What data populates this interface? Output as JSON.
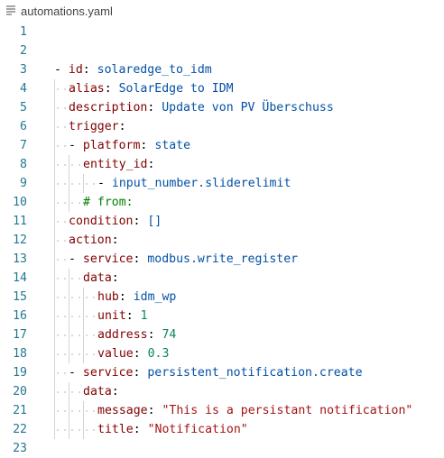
{
  "tab": {
    "icon": "file-lines-icon",
    "filename": "automations.yaml"
  },
  "colors": {
    "line_number": "#237893",
    "key": "#800000",
    "value": "#0451a5",
    "string": "#a31515",
    "number": "#098658",
    "comment": "#008000",
    "indent_guide": "#d3d3d3"
  },
  "lines": [
    {
      "n": "1"
    },
    {
      "n": "2"
    },
    {
      "n": "3",
      "dash": "- ",
      "key": "id",
      "colon": ": ",
      "value": "solaredge_to_idm"
    },
    {
      "n": "4",
      "key": "alias",
      "colon": ": ",
      "value": "SolarEdge to IDM"
    },
    {
      "n": "5",
      "key": "description",
      "colon": ": ",
      "value": "Update von PV Überschuss"
    },
    {
      "n": "6",
      "key": "trigger",
      "colon": ":"
    },
    {
      "n": "7",
      "dash": "- ",
      "key": "platform",
      "colon": ": ",
      "value": "state"
    },
    {
      "n": "8",
      "key": "entity_id",
      "colon": ":"
    },
    {
      "n": "9",
      "dash": "- ",
      "value": "input_number.sliderelimit"
    },
    {
      "n": "10",
      "comment": "# from:"
    },
    {
      "n": "11",
      "key": "condition",
      "colon": ": ",
      "value": "[]"
    },
    {
      "n": "12",
      "key": "action",
      "colon": ":"
    },
    {
      "n": "13",
      "dash": "- ",
      "key": "service",
      "colon": ": ",
      "value": "modbus.write_register"
    },
    {
      "n": "14",
      "key": "data",
      "colon": ":"
    },
    {
      "n": "15",
      "key": "hub",
      "colon": ": ",
      "value": "idm_wp"
    },
    {
      "n": "16",
      "key": "unit",
      "colon": ": ",
      "number": "1"
    },
    {
      "n": "17",
      "key": "address",
      "colon": ": ",
      "number": "74"
    },
    {
      "n": "18",
      "key": "value",
      "colon": ": ",
      "number": "0.3"
    },
    {
      "n": "19",
      "dash": "- ",
      "key": "service",
      "colon": ": ",
      "value": "persistent_notification.create"
    },
    {
      "n": "20",
      "key": "data",
      "colon": ":"
    },
    {
      "n": "21",
      "key": "message",
      "colon": ": ",
      "string": "\"This is a persistant notification\""
    },
    {
      "n": "22",
      "key": "title",
      "colon": ": ",
      "string": "\"Notification\""
    },
    {
      "n": "23"
    }
  ]
}
